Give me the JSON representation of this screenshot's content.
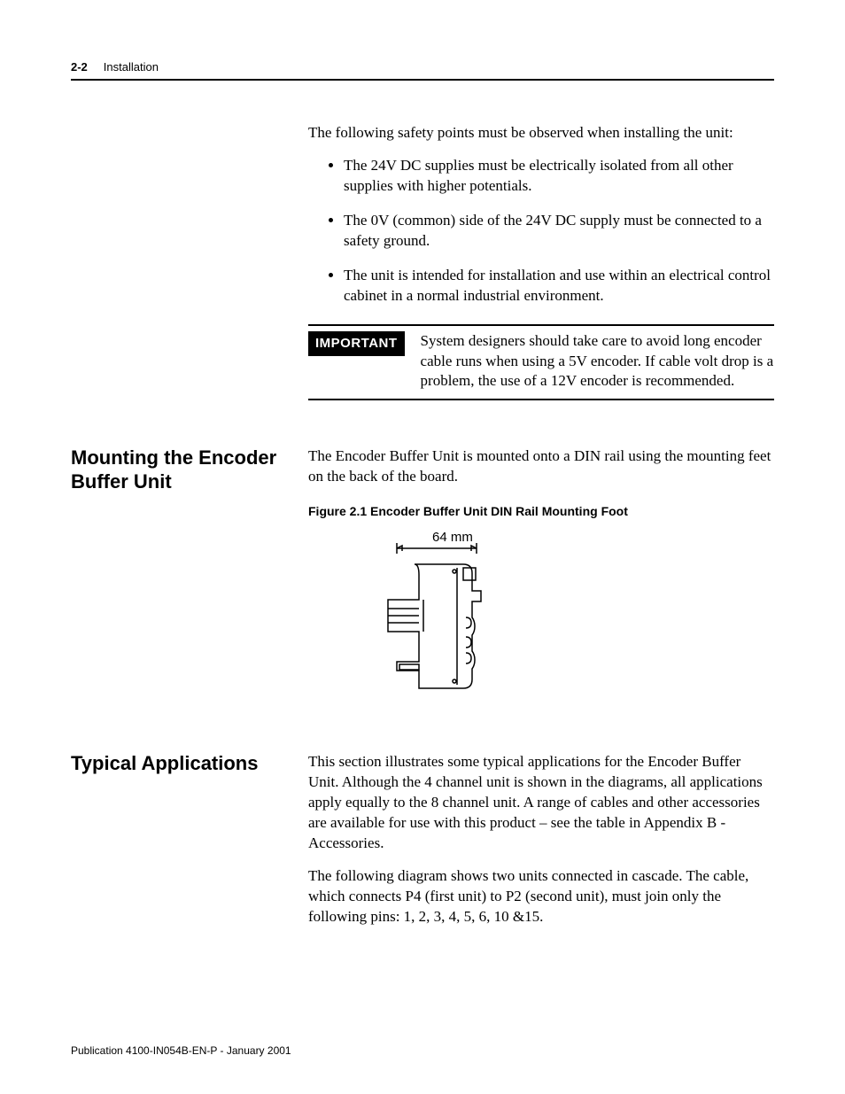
{
  "header": {
    "page_num": "2-2",
    "chapter": "Installation"
  },
  "intro_paragraph": "The following safety points must be observed when installing the unit:",
  "safety_points": [
    "The 24V DC supplies must be electrically isolated from all other supplies with higher potentials.",
    "The 0V (common) side of the 24V DC supply must be connected to a safety ground.",
    "The unit is intended for installation and use within an electrical control cabinet in a normal industrial environment."
  ],
  "important": {
    "label": "IMPORTANT",
    "text": "System designers should take care to avoid long encoder cable runs when using a 5V encoder. If cable volt drop is a problem, the use of a 12V encoder is recommended."
  },
  "sections": {
    "mounting": {
      "heading": "Mounting the Encoder Buffer Unit",
      "body": "The Encoder Buffer Unit is mounted onto a DIN rail using the mounting feet on the back of the board.",
      "figure_caption": "Figure 2.1 Encoder Buffer Unit DIN Rail Mounting Foot",
      "figure_dimension": "64 mm"
    },
    "applications": {
      "heading": "Typical Applications",
      "body1": "This section illustrates some typical applications for the Encoder Buffer Unit. Although the 4 channel unit is shown in the diagrams, all applications apply equally to the 8 channel unit. A range of cables and other accessories are available for use with this product – see the table in Appendix B - Accessories.",
      "body2": "The following diagram shows two units connected in cascade. The cable, which connects P4 (first unit) to P2 (second unit), must join only the following pins: 1, 2, 3, 4, 5, 6, 10 &15."
    }
  },
  "footer": {
    "publication": "Publication 4100-IN054B-EN-P - January 2001"
  }
}
